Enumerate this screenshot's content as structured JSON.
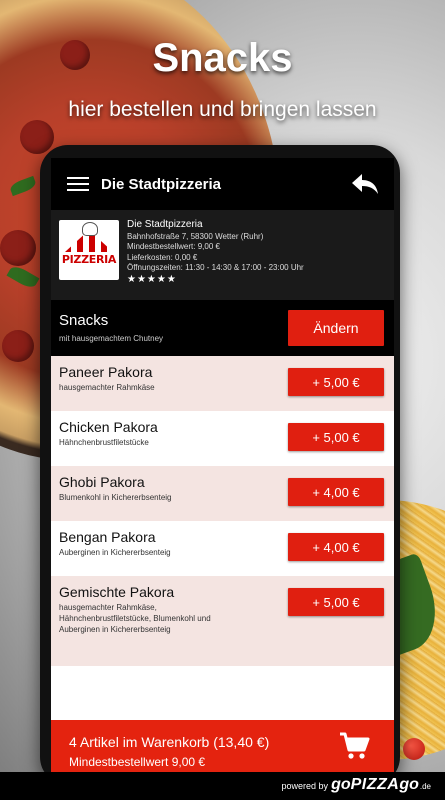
{
  "headline": {
    "title": "Snacks",
    "subtitle": "hier bestellen und bringen lassen"
  },
  "appbar": {
    "title": "Die Stadtpizzeria",
    "menu_icon": "hamburger-menu-icon",
    "back_icon": "back-arrow-icon"
  },
  "restaurant": {
    "logo_text": "PIZZERIA",
    "name": "Die Stadtpizzeria",
    "address": "Bahnhofstraße 7, 58300 Wetter (Ruhr)",
    "min_order": "Mindestbestellwert: 9,00 €",
    "delivery_cost": "Lieferkosten: 0,00 €",
    "hours": "Öffnungszeiten: 11:30 - 14:30 & 17:00 - 23:00 Uhr",
    "stars": "★★★★★",
    "rating": 5
  },
  "category": {
    "title": "Snacks",
    "subtitle": "mit hausgemachtem Chutney",
    "change_label": "Ändern"
  },
  "items": [
    {
      "name": "Paneer Pakora",
      "desc": "hausgemachter Rahmkäse",
      "price": "+ 5,00 €"
    },
    {
      "name": "Chicken Pakora",
      "desc": "Hähnchenbrustfiletstücke",
      "price": "+ 5,00 €"
    },
    {
      "name": "Ghobi Pakora",
      "desc": "Blumenkohl in Kichererbsenteig",
      "price": "+ 4,00 €"
    },
    {
      "name": "Bengan Pakora",
      "desc": "Auberginen in Kichererbsenteig",
      "price": "+ 4,00 €"
    },
    {
      "name": "Gemischte Pakora",
      "desc": "hausgemachter Rahmkäse, Hähnchenbrustfiletstücke, Blumenkohl und Auberginen in Kichererbsenteig",
      "price": "+ 5,00 €"
    }
  ],
  "cart": {
    "summary": "4 Artikel im Warenkorb (13,40 €)",
    "min_order": "Mindestbestellwert 9,00 €",
    "icon": "shopping-cart-icon"
  },
  "footer": {
    "powered_by": "powered by",
    "brand_go": "go",
    "brand_pizza": "PIZZA",
    "brand_go2": "go",
    "tld": ".de"
  },
  "colors": {
    "accent": "#e01f10",
    "cart": "#e4230f",
    "row_shade": "#f4e4e1",
    "appbar": "#000000"
  }
}
